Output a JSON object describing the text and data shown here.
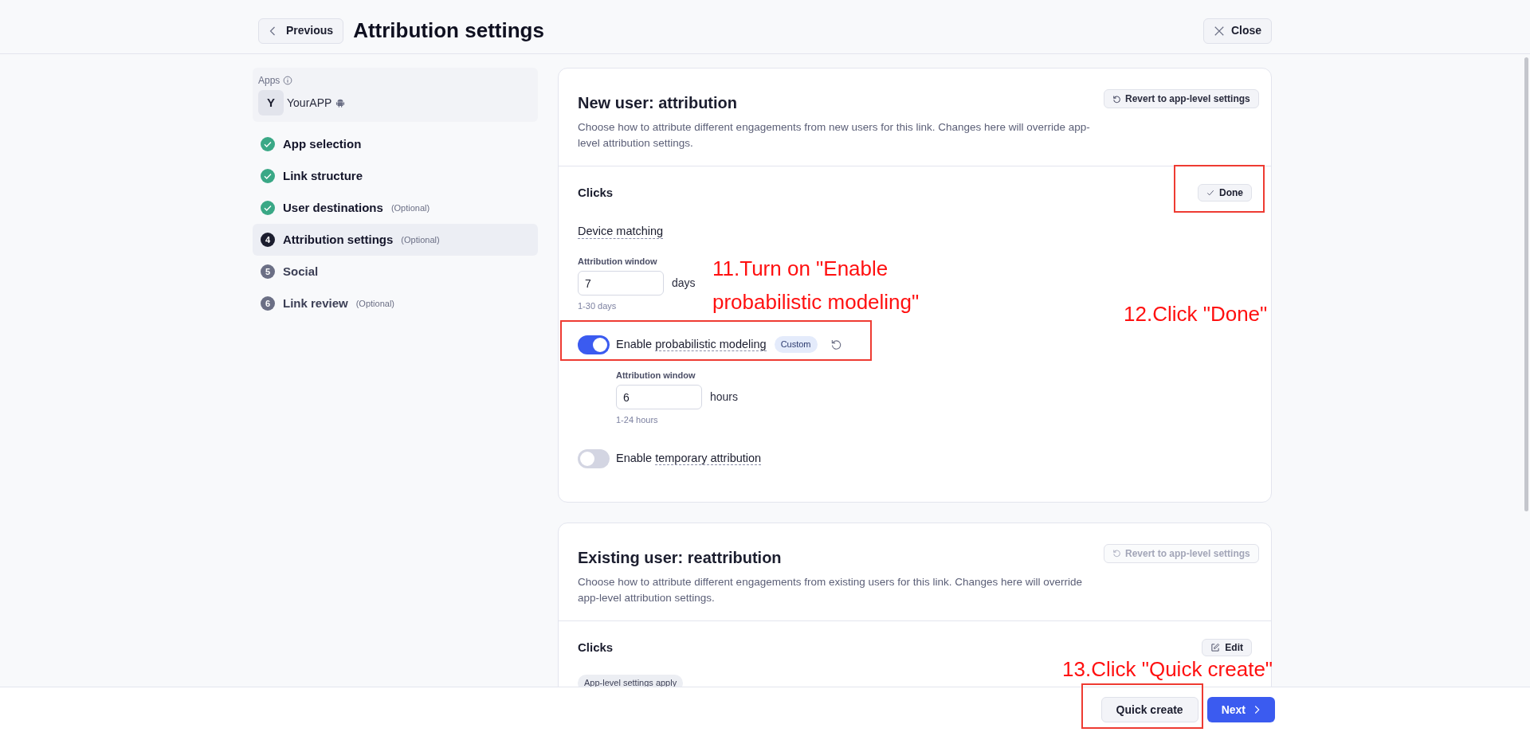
{
  "header": {
    "back_button": "Previous",
    "title": "Attribution settings",
    "close_button": "Close"
  },
  "sidebar": {
    "apps_label": "Apps",
    "app": {
      "initial": "Y",
      "name": "YourAPP"
    },
    "steps": [
      {
        "kind": "done",
        "label": "App selection",
        "selected": false
      },
      {
        "kind": "done",
        "label": "Link structure",
        "selected": false
      },
      {
        "kind": "done",
        "label": "User destinations",
        "note": "(Optional)",
        "selected": false
      },
      {
        "kind": "current",
        "marker": "4",
        "label": "Attribution settings",
        "note": "(Optional)",
        "selected": true
      },
      {
        "kind": "upcoming",
        "marker": "5",
        "label": "Social",
        "selected": false
      },
      {
        "kind": "upcoming",
        "marker": "6",
        "label": "Link review",
        "note": "(Optional)",
        "selected": false
      }
    ]
  },
  "sections": [
    {
      "title": "New user: attribution",
      "description": "Choose how to attribute different engagements from new users for this link. Changes here will override app-level attribution settings.",
      "revert_button": {
        "label": "Revert to app-level settings",
        "disabled": false
      },
      "clicks": {
        "title": "Clicks",
        "action": {
          "kind": "done",
          "label": "Done"
        },
        "device_matching": "Device matching",
        "window": {
          "label": "Attribution window",
          "value": "7",
          "unit": "days",
          "hint": "1-30 days"
        },
        "toggles": [
          {
            "lead": "Enable",
            "term": "probabilistic modeling",
            "on": true,
            "badge": "Custom",
            "window": {
              "label": "Attribution window",
              "value": "6",
              "unit": "hours",
              "hint": "1-24 hours"
            }
          },
          {
            "lead": "Enable",
            "term": "temporary attribution",
            "on": false
          }
        ]
      }
    },
    {
      "title": "Existing user: reattribution",
      "description": "Choose how to attribute different engagements from existing users for this link. Changes here will override app-level attribution settings.",
      "revert_button": {
        "label": "Revert to app-level settings",
        "disabled": true
      },
      "clicks": {
        "title": "Clicks",
        "action": {
          "kind": "edit",
          "label": "Edit"
        },
        "badge": "App-level settings apply"
      }
    }
  ],
  "footer": {
    "buttons": [
      {
        "kind": "secondary",
        "label": "Quick create"
      },
      {
        "kind": "primary",
        "label": "Next"
      }
    ]
  },
  "annotations": [
    {
      "text": "11.Turn on \"Enable probabilistic modeling\""
    },
    {
      "text": "12.Click \"Done\""
    },
    {
      "text": "13.Click \"Quick create\""
    }
  ]
}
